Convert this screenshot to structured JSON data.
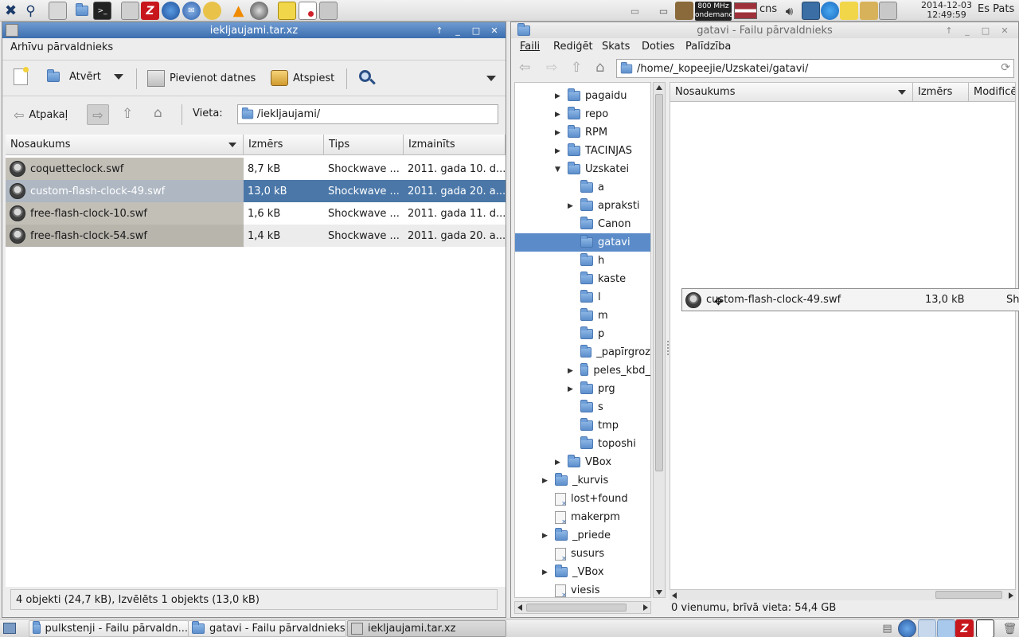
{
  "top_panel": {
    "launchers": [
      "app-menu-icon",
      "search-icon",
      "text-editor-icon",
      "file-manager-icon",
      "terminal-icon",
      "archive-icon",
      "filezilla-icon",
      "browser-icon",
      "mail-icon",
      "paint-icon",
      "vlc-icon",
      "media-icon",
      "notes-icon",
      "screen-record-icon",
      "screenshot-icon"
    ],
    "cpu_freq": "800 MHz",
    "cpu_gov": "ondemand",
    "keyboard_layout": "cns",
    "date": "2014-12-03",
    "time": "12:49:59",
    "user": "Es Pats"
  },
  "archive_window": {
    "title": "iekljaujami.tar.xz",
    "menu_label": "Arhīvu pārvaldnieks",
    "toolbar": {
      "open_label": "Atvērt",
      "add_files_label": "Pievienot datnes",
      "extract_label": "Atspiest"
    },
    "nav": {
      "back_label": "Atpakaļ",
      "location_label": "Vieta:",
      "location_value": "/iekljaujami/"
    },
    "columns": [
      "Nosaukums",
      "Izmērs",
      "Tips",
      "Izmainīts"
    ],
    "files": [
      {
        "name": "coquetteclock.swf",
        "size": "8,7 kB",
        "type": "Shockwave ...",
        "modified": "2011. gada 10. d..."
      },
      {
        "name": "custom-flash-clock-49.swf",
        "size": "13,0 kB",
        "type": "Shockwave ...",
        "modified": "2011. gada 20. a..."
      },
      {
        "name": "free-flash-clock-10.swf",
        "size": "1,6 kB",
        "type": "Shockwave ...",
        "modified": "2011. gada 11. d..."
      },
      {
        "name": "free-flash-clock-54.swf",
        "size": "1,4 kB",
        "type": "Shockwave ...",
        "modified": "2011. gada 20. a..."
      }
    ],
    "status": "4 objekti (24,7 kB), Izvēlēts 1 objekts (13,0 kB)"
  },
  "file_manager_window": {
    "title": "gatavi - Failu pārvaldnieks",
    "menu": [
      "Faili",
      "Rediģēt",
      "Skats",
      "Doties",
      "Palīdzība"
    ],
    "path": "/home/_kopeejie/Uzskatei/gatavi/",
    "tree": [
      {
        "label": "pagaidu",
        "depth": 1,
        "expander": "collapsed",
        "icon": "folder"
      },
      {
        "label": "repo",
        "depth": 1,
        "expander": "collapsed",
        "icon": "folder"
      },
      {
        "label": "RPM",
        "depth": 1,
        "expander": "collapsed",
        "icon": "folder"
      },
      {
        "label": "TACINJAS",
        "depth": 1,
        "expander": "collapsed",
        "icon": "folder"
      },
      {
        "label": "Uzskatei",
        "depth": 1,
        "expander": "expanded",
        "icon": "folder"
      },
      {
        "label": "a",
        "depth": 2,
        "expander": "none",
        "icon": "folder"
      },
      {
        "label": "apraksti",
        "depth": 2,
        "expander": "collapsed",
        "icon": "folder"
      },
      {
        "label": "Canon",
        "depth": 2,
        "expander": "none",
        "icon": "folder"
      },
      {
        "label": "gatavi",
        "depth": 2,
        "expander": "none",
        "icon": "folder",
        "selected": true
      },
      {
        "label": "h",
        "depth": 2,
        "expander": "none",
        "icon": "folder"
      },
      {
        "label": "kaste",
        "depth": 2,
        "expander": "none",
        "icon": "folder"
      },
      {
        "label": "l",
        "depth": 2,
        "expander": "none",
        "icon": "folder"
      },
      {
        "label": "m",
        "depth": 2,
        "expander": "none",
        "icon": "folder"
      },
      {
        "label": "p",
        "depth": 2,
        "expander": "none",
        "icon": "folder"
      },
      {
        "label": "_papīrgroz",
        "depth": 2,
        "expander": "none",
        "icon": "folder"
      },
      {
        "label": "peles_kbd_",
        "depth": 2,
        "expander": "collapsed",
        "icon": "folder"
      },
      {
        "label": "prg",
        "depth": 2,
        "expander": "collapsed",
        "icon": "folder"
      },
      {
        "label": "s",
        "depth": 2,
        "expander": "none",
        "icon": "folder"
      },
      {
        "label": "tmp",
        "depth": 2,
        "expander": "none",
        "icon": "folder"
      },
      {
        "label": "toposhi",
        "depth": 2,
        "expander": "none",
        "icon": "folder"
      },
      {
        "label": "VBox",
        "depth": 1,
        "expander": "collapsed",
        "icon": "folder"
      },
      {
        "label": "_kurvis",
        "depth": 0,
        "expander": "collapsed",
        "icon": "folder"
      },
      {
        "label": "lost+found",
        "depth": 0,
        "expander": "none",
        "icon": "file"
      },
      {
        "label": "makerpm",
        "depth": 0,
        "expander": "none",
        "icon": "file"
      },
      {
        "label": "_priede",
        "depth": 0,
        "expander": "collapsed",
        "icon": "folder"
      },
      {
        "label": "susurs",
        "depth": 0,
        "expander": "none",
        "icon": "file"
      },
      {
        "label": "_VBox",
        "depth": 0,
        "expander": "collapsed",
        "icon": "folder"
      },
      {
        "label": "viesis",
        "depth": 0,
        "expander": "none",
        "icon": "file"
      }
    ],
    "columns": [
      "Nosaukums",
      "Izmērs",
      "Modificē"
    ],
    "drag_item": {
      "name": "custom-flash-clock-49.swf",
      "size": "13,0 kB",
      "type_prefix": "Sho"
    },
    "status": "0 vienumu, brīvā vieta: 54,4 GB"
  },
  "taskbar": {
    "tasks": [
      {
        "label": "pulkstenji - Failu pārvaldn...",
        "icon": "folder"
      },
      {
        "label": "gatavi - Failu pārvaldnieks",
        "icon": "folder"
      },
      {
        "label": "iekljaujami.tar.xz",
        "icon": "archive"
      }
    ]
  },
  "colors": {
    "active_titlebar": "#3c6fb0",
    "selection": "#4a77a8",
    "tree_selection": "#5b8cc9",
    "row_shade": "#c2bfb7"
  }
}
